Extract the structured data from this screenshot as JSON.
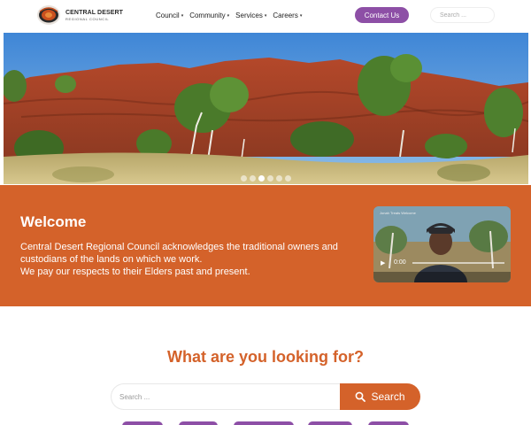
{
  "header": {
    "logo_title": "CENTRAL DESERT",
    "logo_subtitle": "REGIONAL COUNCIL",
    "nav": [
      {
        "label": "Council"
      },
      {
        "label": "Community"
      },
      {
        "label": "Services"
      },
      {
        "label": "Careers"
      }
    ],
    "contact_label": "Contact Us",
    "search_placeholder": "Search ..."
  },
  "hero": {
    "slide_count": 6,
    "active_slide": 3
  },
  "welcome": {
    "title": "Welcome",
    "lines": [
      "Central Desert Regional Council acknowledges the traditional owners and",
      "custodians of the lands on which we work.",
      "We pay our respects to their Elders past and present."
    ],
    "video": {
      "title": "Jonah Treats Welcome",
      "time": "0:00"
    }
  },
  "search_section": {
    "heading": "What are you looking for?",
    "placeholder": "Search ...",
    "button_label": "Search"
  },
  "colors": {
    "accent_orange": "#d4622a",
    "accent_purple": "#8d4fa6"
  }
}
